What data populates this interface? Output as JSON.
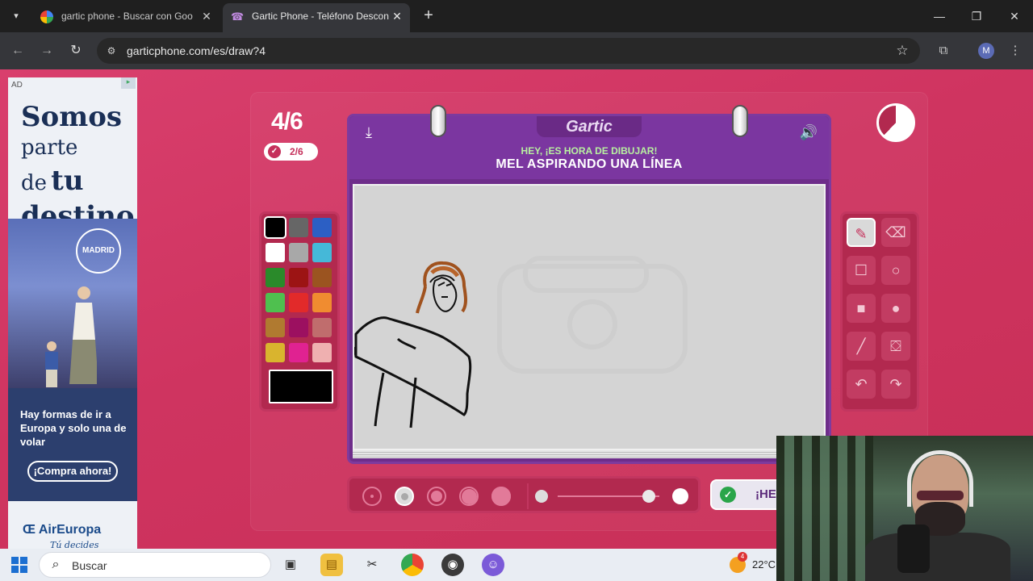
{
  "browser": {
    "tabs": [
      {
        "title": "gartic phone - Buscar con Goo",
        "favicon": "google-g-icon"
      },
      {
        "title": "Gartic Phone - Teléfono Descon",
        "favicon": "gartic-icon"
      }
    ],
    "url": "garticphone.com/es/draw?4",
    "profile_initial": "M"
  },
  "ad": {
    "badge": "AD",
    "headline": [
      "Somos",
      "parte",
      "de",
      "tu",
      "destino"
    ],
    "seal": "MADRID",
    "body": "Hay formas de ir a Europa y solo una de volar",
    "cta": "¡Compra ahora!",
    "brand": "AirEuropa",
    "tagline": "Tú decides"
  },
  "game": {
    "round": "4/6",
    "players_done": "2/6",
    "logo": "Gartic",
    "prompt_intro": "HEY, ¡ES HORA DE DIBUJAR!",
    "prompt": "MEL ASPIRANDO UNA LÍNEA",
    "done_button": "¡HE",
    "timer_remaining_fraction": 0.62,
    "selected_color": "#000000",
    "palette": [
      "#000000",
      "#666666",
      "#2c5fc4",
      "#ffffff",
      "#a8a8a8",
      "#45b8d8",
      "#2a8a2a",
      "#9c1414",
      "#9b5420",
      "#4fc04f",
      "#e22a2a",
      "#f08c30",
      "#b07a30",
      "#9c1060",
      "#c06d6d",
      "#d9b42e",
      "#e02291",
      "#efb0b0"
    ],
    "tools": [
      {
        "name": "pencil-tool",
        "glyph": "✎",
        "selected": true
      },
      {
        "name": "eraser-tool",
        "glyph": "⌫",
        "selected": false
      },
      {
        "name": "rectangle-outline-tool",
        "glyph": "☐",
        "selected": false
      },
      {
        "name": "ellipse-outline-tool",
        "glyph": "○",
        "selected": false
      },
      {
        "name": "rectangle-fill-tool",
        "glyph": "■",
        "selected": false
      },
      {
        "name": "ellipse-fill-tool",
        "glyph": "●",
        "selected": false
      },
      {
        "name": "line-tool",
        "glyph": "╱",
        "selected": false
      },
      {
        "name": "fill-bucket-tool",
        "glyph": "⛋",
        "selected": false
      },
      {
        "name": "undo-tool",
        "glyph": "↶",
        "selected": false
      },
      {
        "name": "redo-tool",
        "glyph": "↷",
        "selected": false
      }
    ],
    "brush_sizes": 5,
    "selected_brush_size": 2,
    "opacity_level": 0.9
  },
  "taskbar": {
    "search_placeholder": "Buscar",
    "weather": "22°C",
    "weather_badge": "4"
  }
}
